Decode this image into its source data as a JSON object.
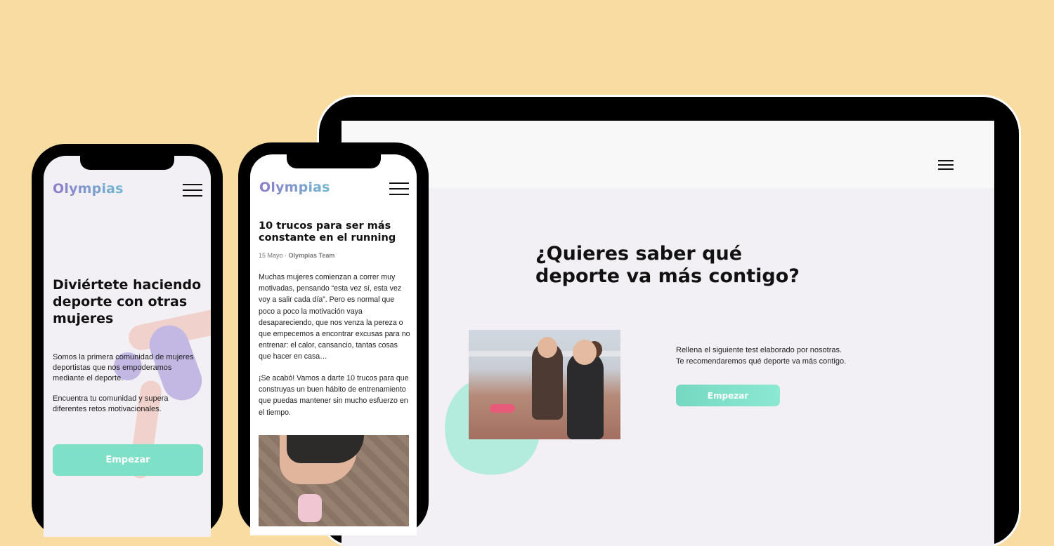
{
  "tablet": {
    "title": "¿Quieres saber qué deporte va más contigo?",
    "text_line1": "Rellena el siguiente test elaborado por nosotras.",
    "text_line2": "Te recomendaremos  qué deporte va más contigo.",
    "button": "Empezar"
  },
  "phone1": {
    "logo": "Olympias",
    "title": "Diviértete haciendo deporte con otras mujeres",
    "text1": "Somos la primera comunidad de mujeres deportistas que nos empoderamos mediante el deporte.",
    "text2": "Encuentra tu comunidad y supera diferentes retos motivacionales.",
    "button": "Empezar"
  },
  "phone2": {
    "logo": "Olympias",
    "title": "10 trucos para ser más constante en el running",
    "date": "15 Mayo · ",
    "author": "Olympias Team",
    "paragraph1": "Muchas mujeres comienzan a correr muy motivadas, pensando “esta vez sí, esta vez voy a salir cada día”. Pero es normal que poco a poco la motivación vaya desapareciendo, que nos venza la pereza o que empecemos a encontrar excusas para no entrenar: el calor, cansancio, tantas cosas que hacer en casa…",
    "paragraph2": "¡Se acabó! Vamos a darte 10 trucos para que construyas un buen hábito de entrenamiento que puedas mantener sin mucho esfuerzo en el tiempo."
  },
  "colors": {
    "background": "#f8dca2",
    "accent": "#7fe0c8",
    "logo_gradient_start": "#8c7cc9",
    "logo_gradient_end": "#6fb7d2"
  },
  "icons": [
    "hamburger-menu-icon"
  ]
}
